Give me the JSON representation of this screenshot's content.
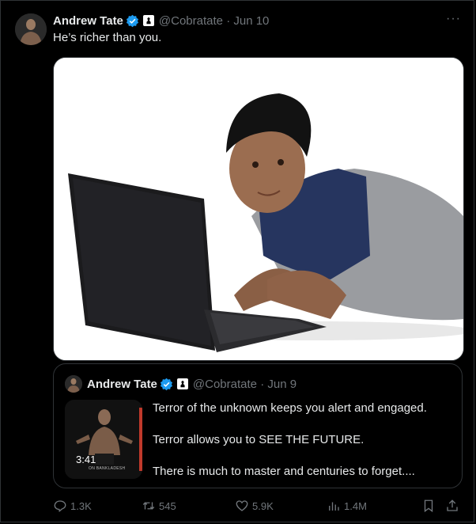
{
  "tweet": {
    "author_name": "Andrew Tate",
    "handle": "@Cobratate",
    "date": "· Jun 10",
    "text": "He’s richer than you."
  },
  "quoted": {
    "author_name": "Andrew Tate",
    "handle": "@Cobratate",
    "date": "· Jun 9",
    "video_duration": "3:41",
    "thumb_brand": "ON BANKLADESH",
    "lines": [
      "Terror of the unknown keeps you alert and engaged.",
      "Terror allows you to SEE THE FUTURE.",
      "There is much to master and centuries to forget...."
    ]
  },
  "actions": {
    "replies": "1.3K",
    "reposts": "545",
    "likes": "5.9K",
    "views": "1.4M"
  },
  "colors": {
    "background": "#000000",
    "text": "#e7e9ea",
    "muted": "#71767b",
    "verified": "#1d9bf0",
    "border": "#2f3336"
  }
}
